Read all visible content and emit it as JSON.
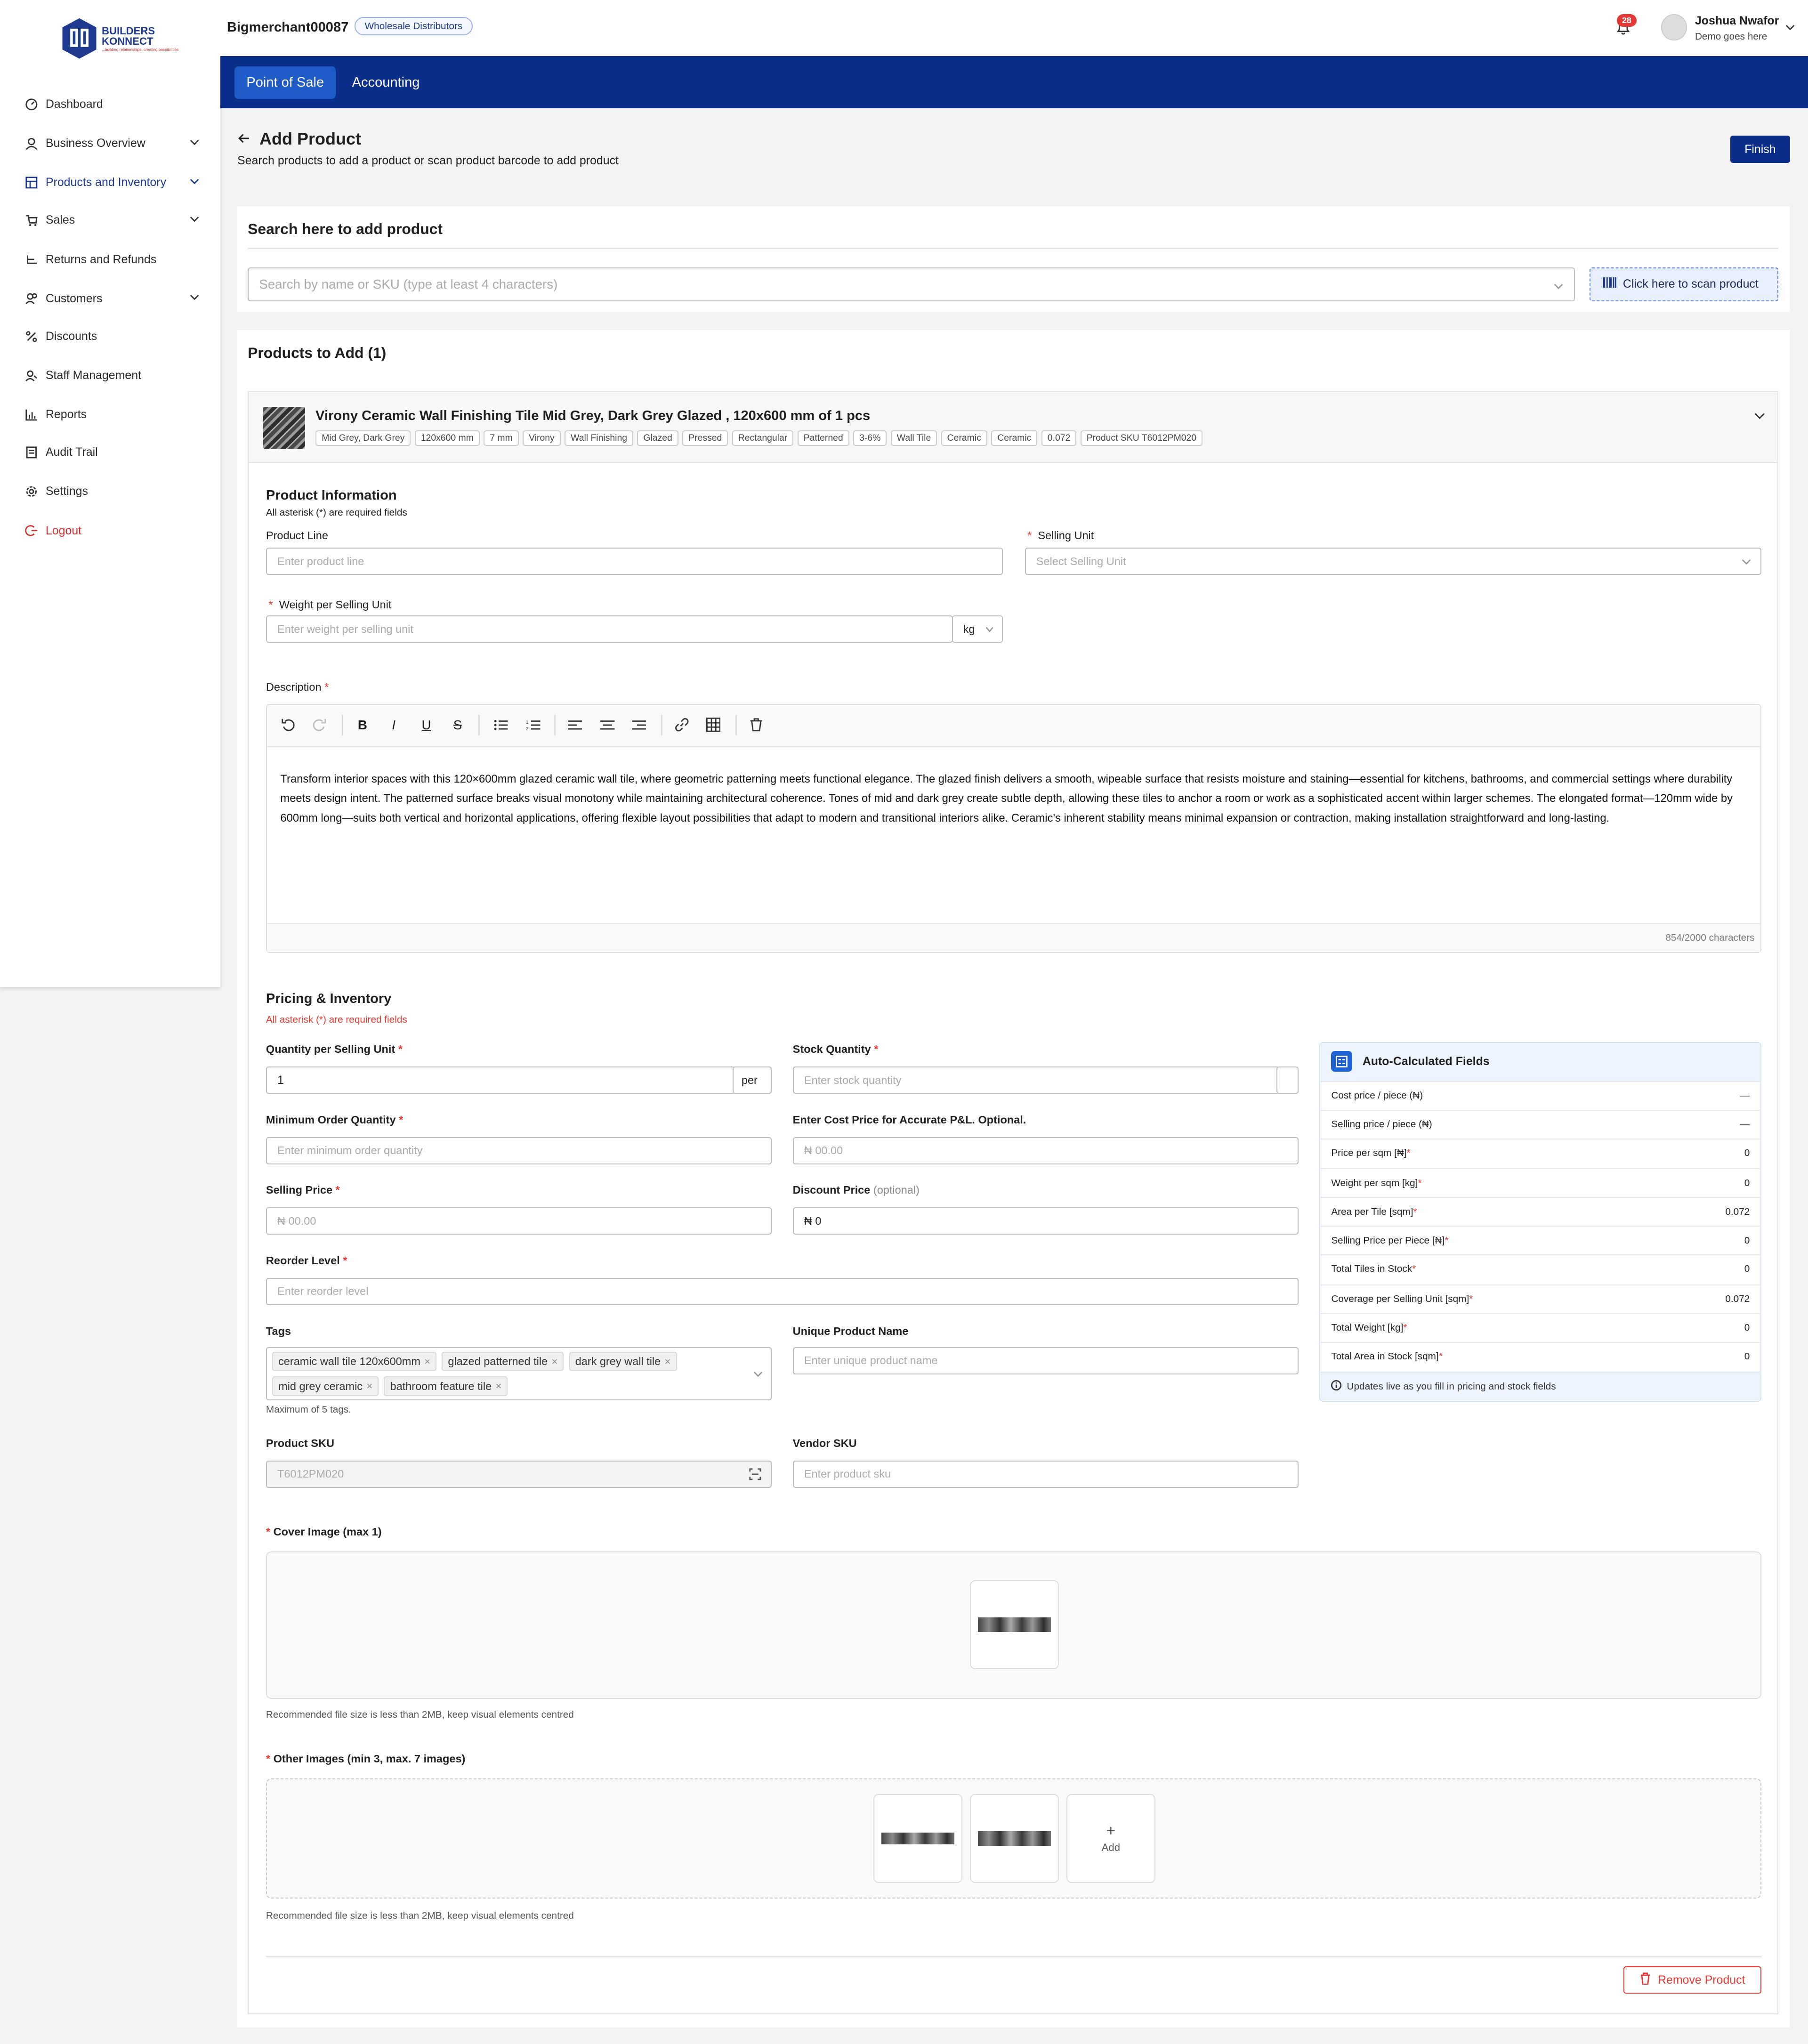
{
  "app": {
    "brand_top": "BUILDERS",
    "brand_bottom": "KONNECT",
    "brand_tagline": "...building relationships, creating possibilities"
  },
  "sidebar": {
    "items": [
      {
        "label": "Dashboard",
        "icon": "dashboard-icon"
      },
      {
        "label": "Business Overview",
        "icon": "user-icon",
        "chevron": true
      },
      {
        "label": "Products and Inventory",
        "icon": "inventory-icon",
        "chevron": true,
        "active": true
      },
      {
        "label": "Sales",
        "icon": "cart-icon",
        "chevron": true
      },
      {
        "label": "Returns and Refunds",
        "icon": "returns-icon"
      },
      {
        "label": "Customers",
        "icon": "customers-icon",
        "chevron": true
      },
      {
        "label": "Discounts",
        "icon": "percent-icon"
      },
      {
        "label": "Staff Management",
        "icon": "staff-icon"
      },
      {
        "label": "Reports",
        "icon": "chart-icon"
      },
      {
        "label": "Audit Trail",
        "icon": "audit-icon"
      },
      {
        "label": "Settings",
        "icon": "gear-icon"
      },
      {
        "label": "Logout",
        "icon": "logout-icon"
      }
    ]
  },
  "topbar": {
    "merchant": "Bigmerchant00087",
    "merchant_type": "Wholesale Distributors",
    "notifications": "28",
    "user_name": "Joshua Nwafor",
    "user_sub": "Demo goes here"
  },
  "tabs": [
    {
      "label": "Point of Sale",
      "active": true
    },
    {
      "label": "Accounting",
      "active": false
    }
  ],
  "header": {
    "title": "Add Product",
    "subtitle": "Search products to add a product or scan product barcode to add product",
    "finish": "Finish"
  },
  "search": {
    "title": "Search here to add product",
    "placeholder": "Search by name or SKU (type at least 4 characters)",
    "scan_label": "Click here to scan product"
  },
  "products": {
    "title": "Products to Add (1)"
  },
  "product": {
    "name": "Virony Ceramic Wall Finishing Tile Mid Grey, Dark Grey Glazed , 120x600 mm of 1 pcs",
    "chips": [
      "Mid Grey, Dark Grey",
      "120x600 mm",
      "7 mm",
      "Virony",
      "Wall Finishing",
      "Glazed",
      "Pressed",
      "Rectangular",
      "Patterned",
      "3-6%",
      "Wall Tile",
      "Ceramic",
      "Ceramic",
      "0.072",
      "Product SKU T6012PM020"
    ]
  },
  "info": {
    "title": "Product Information",
    "note": "All asterisk (*) are required fields",
    "product_line_label": "Product Line",
    "product_line_ph": "Enter product line",
    "selling_unit_label": "Selling Unit",
    "selling_unit_ph": "Select Selling Unit",
    "weight_label": "Weight per Selling Unit",
    "weight_ph": "Enter weight per selling unit",
    "weight_unit": "kg",
    "description_label": "Description",
    "description": "Transform interior spaces with this 120×600mm glazed ceramic wall tile, where geometric patterning meets functional elegance. The glazed finish delivers a smooth, wipeable surface that resists moisture and staining—essential for kitchens, bathrooms, and commercial settings where durability meets design intent. The patterned surface breaks visual monotony while maintaining architectural coherence. Tones of mid and dark grey create subtle depth, allowing these tiles to anchor a room or work as a sophisticated accent within larger schemes. The elongated format—120mm wide by 600mm long—suits both vertical and horizontal applications, offering flexible layout possibilities that adapt to modern and transitional interiors alike. Ceramic's inherent stability means minimal expansion or contraction, making installation straightforward and long-lasting.",
    "char_count": "854/2000 characters"
  },
  "pricing": {
    "title": "Pricing & Inventory",
    "note": "All asterisk (*) are required fields",
    "qty_label": "Quantity per Selling Unit",
    "qty_value": "1",
    "qty_suffix": "per",
    "stock_label": "Stock Quantity",
    "stock_ph": "Enter stock quantity",
    "min_label": "Minimum Order Quantity",
    "min_ph": "Enter minimum order quantity",
    "cost_label": "Enter Cost Price for Accurate P&L. Optional.",
    "cost_ph": "₦ 00.00",
    "sell_label": "Selling Price",
    "sell_ph": "₦ 00.00",
    "disc_label": "Discount Price",
    "disc_opt": "(optional)",
    "disc_value": "₦ 0",
    "reorder_label": "Reorder Level",
    "reorder_ph": "Enter reorder level",
    "tags_label": "Tags",
    "tags": [
      "ceramic wall tile 120x600mm",
      "glazed patterned tile",
      "dark grey wall tile",
      "mid grey ceramic",
      "bathroom feature tile"
    ],
    "tags_note": "Maximum of 5 tags.",
    "unique_label": "Unique Product Name",
    "unique_ph": "Enter unique product name",
    "sku_label": "Product SKU",
    "sku_value": "T6012PM020",
    "vendor_label": "Vendor SKU",
    "vendor_ph": "Enter product sku"
  },
  "auto": {
    "title": "Auto-Calculated Fields",
    "rows": [
      {
        "label": "Cost price / piece (₦)",
        "value": "—"
      },
      {
        "label": "Selling price / piece (₦)",
        "value": "—"
      },
      {
        "label": "Price per sqm [₦]",
        "value": "0",
        "req": true
      },
      {
        "label": "Weight per sqm [kg]",
        "value": "0",
        "req": true
      },
      {
        "label": "Area per Tile [sqm]",
        "value": "0.072",
        "req": true
      },
      {
        "label": "Selling Price per Piece [₦]",
        "value": "0",
        "req": true
      },
      {
        "label": "Total Tiles in Stock",
        "value": "0",
        "req": true
      },
      {
        "label": "Coverage per Selling Unit [sqm]",
        "value": "0.072",
        "req": true
      },
      {
        "label": "Total Weight [kg]",
        "value": "0",
        "req": true
      },
      {
        "label": "Total Area in Stock [sqm]",
        "value": "0",
        "req": true
      }
    ],
    "footer": "Updates live as you fill in pricing and stock fields"
  },
  "images": {
    "cover_label": "Cover Image (max 1)",
    "cover_note": "Recommended file size is less than 2MB, keep visual elements centred",
    "other_label": "Other Images (min 3, max. 7 images)",
    "other_note": "Recommended file size is less than 2MB, keep visual elements centred",
    "add_label": "Add"
  },
  "remove_label": "Remove Product",
  "colors": {
    "primary": "#0a2e8a",
    "tab_active": "#1e5bc6",
    "danger": "#e53935"
  }
}
